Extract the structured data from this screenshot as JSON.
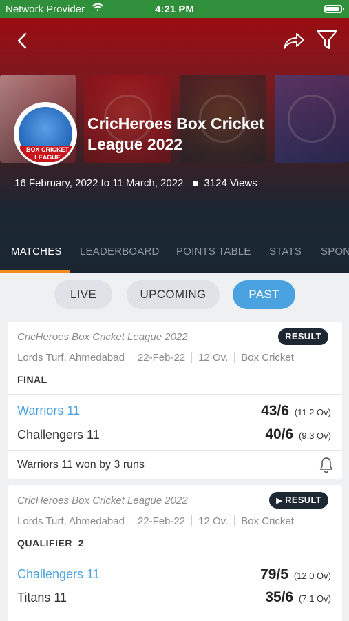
{
  "status_bar": {
    "carrier": "Network Provider",
    "time": "4:21 PM"
  },
  "header": {
    "title": "CricHeroes Box Cricket League 2022",
    "logo_text": "BOX CRICKET LEAGUE",
    "dates": "16 February, 2022 to 11 March, 2022",
    "views": "3124 Views"
  },
  "tabs": [
    "MATCHES",
    "LEADERBOARD",
    "POINTS TABLE",
    "STATS",
    "SPON"
  ],
  "active_tab": "MATCHES",
  "filters": [
    "LIVE",
    "UPCOMING",
    "PAST"
  ],
  "active_filter": "PAST",
  "matches": [
    {
      "league": "CricHeroes Box Cricket League 2022",
      "badge": "RESULT",
      "venue": "Lords Turf, Ahmedabad",
      "date": "22-Feb-22",
      "overs": "12 Ov.",
      "format": "Box Cricket",
      "stage": "FINAL",
      "team1": {
        "name": "Warriors 11",
        "score": "43/6",
        "overs": "(11.2 Ov)"
      },
      "team2": {
        "name": "Challengers 11",
        "score": "40/6",
        "overs": "(9.3 Ov)"
      },
      "result": "Warriors 11 won by 3 runs"
    },
    {
      "league": "CricHeroes Box Cricket League 2022",
      "badge": "RESULT",
      "venue": "Lords Turf, Ahmedabad",
      "date": "22-Feb-22",
      "overs": "12 Ov.",
      "format": "Box Cricket",
      "stage": "QUALIFIER  2",
      "team1": {
        "name": "Challengers 11",
        "score": "79/5",
        "overs": "(12.0 Ov)"
      },
      "team2": {
        "name": "Titans 11",
        "score": "35/6",
        "overs": "(7.1 Ov)"
      }
    }
  ],
  "colors": {
    "accent": "#4aa3e0",
    "tab_indicator": "#f28c1c",
    "status_bar": "#2f8f3a",
    "badge": "#1d2833"
  }
}
